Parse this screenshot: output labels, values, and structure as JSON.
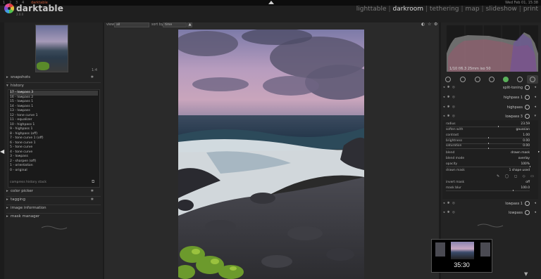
{
  "system_bar": {
    "workspaces": [
      "1",
      "2",
      "3",
      "4"
    ],
    "app": "darktable",
    "clock": "Wed Feb 01, 15:38"
  },
  "app": {
    "name": "darktable",
    "version": "2.0.0"
  },
  "views": {
    "items": [
      "lighttable",
      "darkroom",
      "tethering",
      "map",
      "slideshow",
      "print"
    ],
    "active": "darkroom",
    "separator": "|"
  },
  "left_panel": {
    "nav_zoom": "1:4",
    "sections": {
      "snapshots": "snapshots",
      "history": "history",
      "color_picker": "color picker",
      "tagging": "tagging",
      "image_information": "image information",
      "mask_manager": "mask manager"
    },
    "history_items": [
      "17 - lowpass 3",
      "16 - lowpass 2",
      "15 - lowpass 1",
      "14 - lowpass 1",
      "13 - lowpass",
      "12 - tone curve 1",
      "11 - equalizer",
      "10 - highpass 1",
      "9 - highpass 1",
      "8 - highpass (off)",
      "7 - tone curve 1 (off)",
      "6 - tone curve 1",
      "5 - tone curve",
      "4 - tone curve",
      "3 - lowpass",
      "2 - sharpen (off)",
      "1 - orientation",
      "0 - original"
    ],
    "compress_label": "compress history stack"
  },
  "center_toolbar": {
    "view_label": "view",
    "view_value": "all",
    "sort_label": "sort by",
    "sort_value": "time",
    "sort_dir": "▲"
  },
  "right_panel": {
    "histogram_info": "1/10 f/6.3 25mm iso 50",
    "modules": {
      "split_toning": "split-toning",
      "highpass_1": "highpass 1",
      "highpass": "highpass",
      "lowpass_3": "lowpass 3",
      "lowpass_1": "lowpass 1",
      "lowpass": "lowpass"
    },
    "lowpass_params": [
      {
        "label": "radius",
        "value": "23.59"
      },
      {
        "label": "soften with",
        "value": "gaussian"
      },
      {
        "label": "contrast",
        "value": "1.00"
      },
      {
        "label": "brightness",
        "value": "0.00"
      },
      {
        "label": "saturation",
        "value": "0.00"
      },
      {
        "label": "blend",
        "value": "drawn mask"
      },
      {
        "label": "blend mode",
        "value": "overlay"
      },
      {
        "label": "opacity",
        "value": "100%"
      },
      {
        "label": "drawn mask",
        "value": "1 shape used"
      },
      {
        "label": "invert mask",
        "value": "off"
      },
      {
        "label": "mask blur",
        "value": "100.0"
      }
    ],
    "mask_tools": "✎ ◯ ◻ ◇ ▭"
  },
  "video": {
    "time": "35:30"
  },
  "colors": {
    "accent_active": "#5ab05a",
    "background": "#1c1c1c",
    "panel": "#232323"
  }
}
